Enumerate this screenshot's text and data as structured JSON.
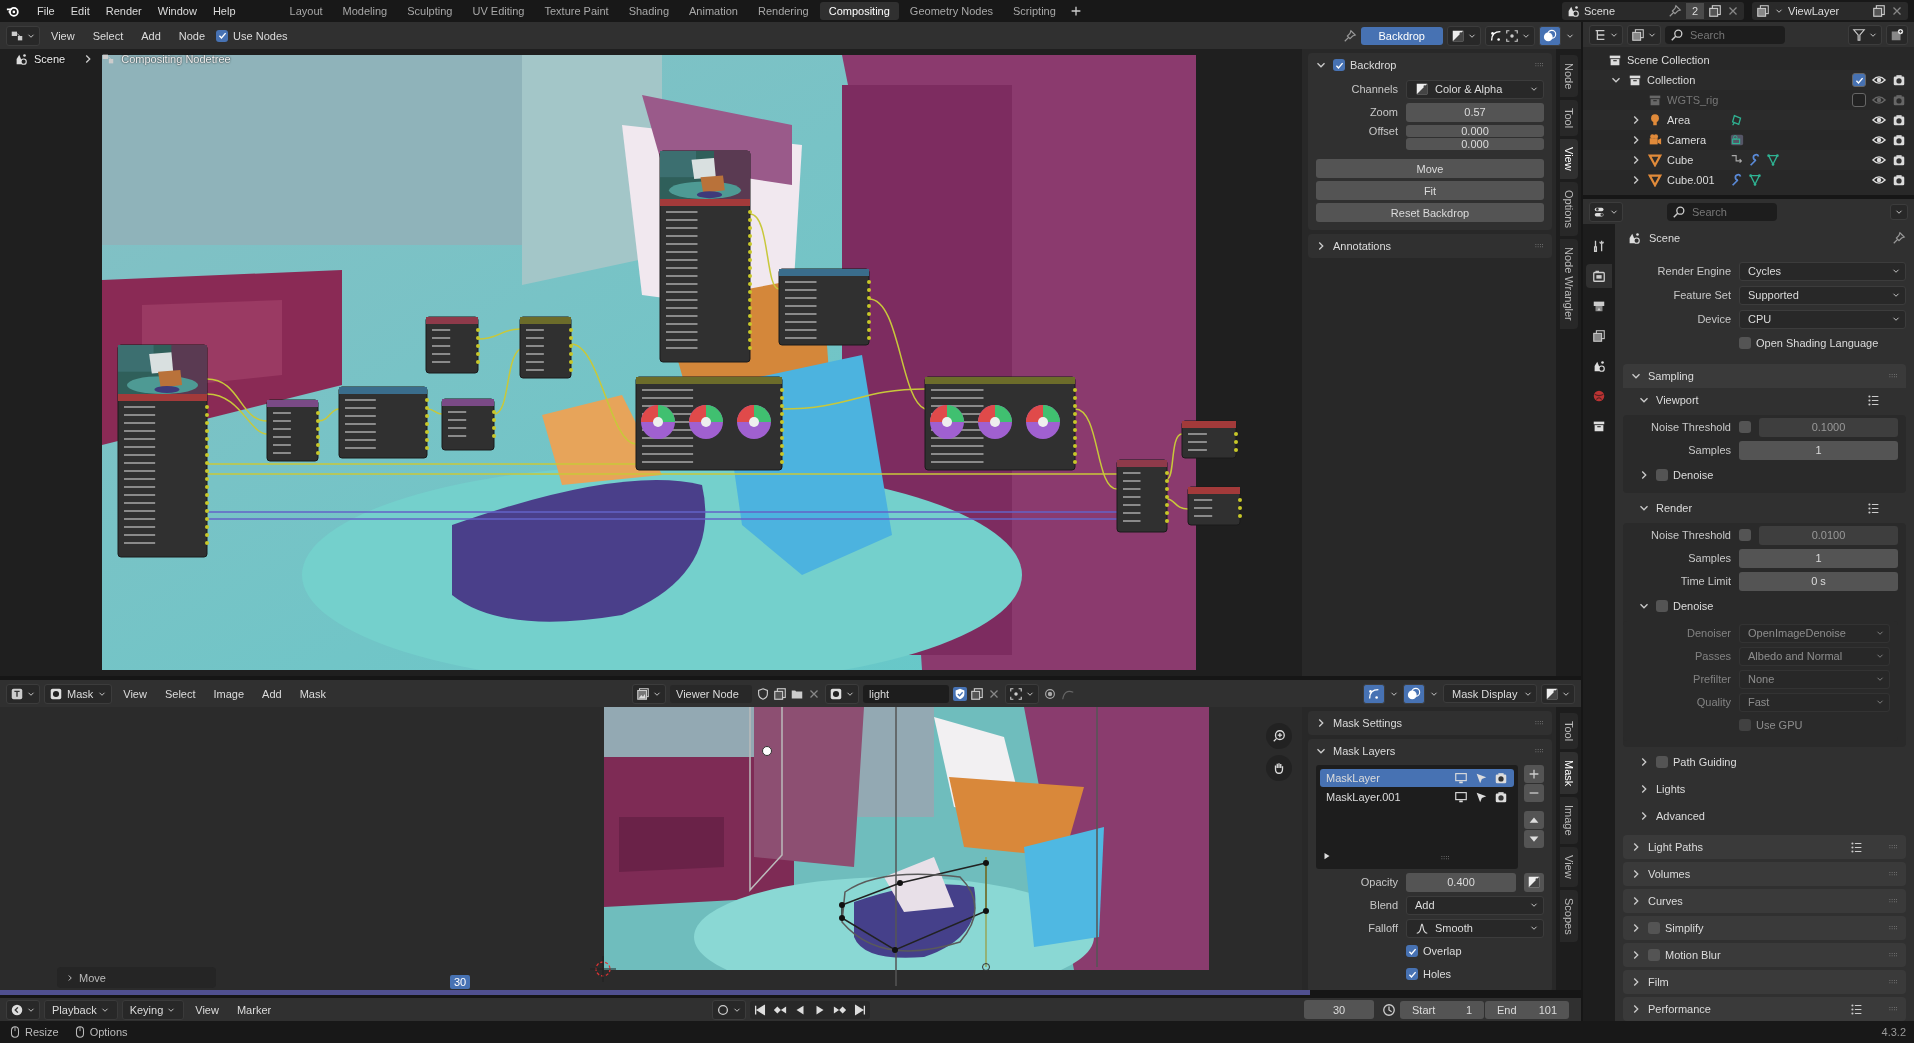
{
  "top_bar": {
    "menus": [
      "File",
      "Edit",
      "Render",
      "Window",
      "Help"
    ],
    "workspaces": [
      {
        "label": "Layout",
        "selected": false
      },
      {
        "label": "Modeling",
        "selected": false
      },
      {
        "label": "Sculpting",
        "selected": false
      },
      {
        "label": "UV Editing",
        "selected": false
      },
      {
        "label": "Texture Paint",
        "selected": false
      },
      {
        "label": "Shading",
        "selected": false
      },
      {
        "label": "Animation",
        "selected": false
      },
      {
        "label": "Rendering",
        "selected": false
      },
      {
        "label": "Compositing",
        "selected": true
      },
      {
        "label": "Geometry Nodes",
        "selected": false
      },
      {
        "label": "Scripting",
        "selected": false
      }
    ],
    "scene": "Scene",
    "scene_users": "2",
    "view_layer": "ViewLayer"
  },
  "node_editor": {
    "menus": [
      "View",
      "Select",
      "Add",
      "Node"
    ],
    "use_nodes": {
      "label": "Use Nodes",
      "checked": true
    },
    "backdrop_button": {
      "label": "Backdrop",
      "on": true
    },
    "breadcrumbs": [
      "Scene",
      "Compositing Nodetree"
    ],
    "sidebar": {
      "tabs": [
        {
          "label": "Node",
          "selected": false
        },
        {
          "label": "Tool",
          "selected": false
        },
        {
          "label": "View",
          "selected": true
        },
        {
          "label": "Options",
          "selected": false
        },
        {
          "label": "Node Wrangler",
          "selected": false
        }
      ],
      "panels": [
        {
          "title": "Backdrop",
          "checked": true,
          "expanded": true,
          "rows": [
            {
              "kind": "channels-dropdown",
              "label": "Channels",
              "value": "Color & Alpha"
            },
            {
              "kind": "number",
              "label": "Zoom",
              "value": "0.57"
            },
            {
              "kind": "vector",
              "label": "Offset",
              "values": [
                "0.000",
                "0.000"
              ]
            },
            {
              "kind": "button",
              "label": "Move"
            },
            {
              "kind": "button",
              "label": "Fit"
            },
            {
              "kind": "button",
              "label": "Reset Backdrop"
            }
          ]
        },
        {
          "title": "Annotations",
          "expanded": false
        }
      ]
    }
  },
  "image_editor": {
    "mode": "Mask",
    "menus": [
      "View",
      "Select",
      "Image",
      "Add",
      "Mask"
    ],
    "image": "Viewer Node",
    "mask": "light",
    "mask_display": "Mask Display",
    "last_operator": "Move",
    "current_frame": "30",
    "sidebar": {
      "tabs": [
        {
          "label": "Tool",
          "selected": false
        },
        {
          "label": "Mask",
          "selected": true
        },
        {
          "label": "Image",
          "selected": false
        },
        {
          "label": "View",
          "selected": false
        },
        {
          "label": "Scopes",
          "selected": false
        }
      ],
      "panels": [
        {
          "title": "Mask Settings",
          "expanded": false
        },
        {
          "title": "Mask Layers",
          "expanded": true,
          "layers": [
            {
              "name": "MaskLayer",
              "selected": true
            },
            {
              "name": "MaskLayer.001",
              "selected": false
            }
          ],
          "rows": [
            {
              "kind": "number-toggle",
              "label": "Opacity",
              "value": "0.400"
            },
            {
              "kind": "dropdown",
              "label": "Blend",
              "value": "Add"
            },
            {
              "kind": "falloff-dropdown",
              "label": "Falloff",
              "value": "Smooth"
            },
            {
              "kind": "checkbox",
              "label": "Overlap",
              "checked": true
            },
            {
              "kind": "checkbox",
              "label": "Holes",
              "checked": true
            }
          ]
        }
      ]
    }
  },
  "timeline": {
    "menus": [
      "Playback",
      "Keying",
      "View",
      "Marker"
    ],
    "current_frame": "30",
    "start_label": "Start",
    "start": "1",
    "end_label": "End",
    "end": "101"
  },
  "status_bar": {
    "items": [
      "Resize",
      "Options"
    ],
    "version": "4.3.2"
  },
  "outliner": {
    "search_placeholder": "Search",
    "tree": [
      {
        "label": "Scene Collection",
        "kind": "scene-collection",
        "children": [
          {
            "label": "Collection",
            "kind": "collection",
            "expanded": true,
            "checked": true,
            "children": [
              {
                "label": "WGTS_rig",
                "kind": "collection",
                "checked": false
              },
              {
                "label": "Area",
                "kind": "light",
                "expanded": false,
                "constraint": false,
                "modifier": false
              },
              {
                "label": "Camera",
                "kind": "camera",
                "expanded": false,
                "constraint": false,
                "modifier": false
              },
              {
                "label": "Cube",
                "kind": "mesh",
                "expanded": false,
                "constraint": true,
                "modifier": true
              },
              {
                "label": "Cube.001",
                "kind": "mesh",
                "expanded": false,
                "constraint": false,
                "modifier": true
              }
            ]
          }
        ]
      }
    ]
  },
  "properties": {
    "search_placeholder": "Search",
    "context": "Scene",
    "tabs": [
      {
        "kind": "tool",
        "selected": false
      },
      {
        "kind": "render",
        "selected": true
      },
      {
        "kind": "output",
        "selected": false
      },
      {
        "kind": "view-layer",
        "selected": false
      },
      {
        "kind": "scene",
        "selected": false
      },
      {
        "kind": "world",
        "selected": false
      },
      {
        "kind": "collection",
        "selected": false
      }
    ],
    "rows": [
      {
        "kind": "dropdown",
        "label": "Render Engine",
        "value": "Cycles"
      },
      {
        "kind": "dropdown",
        "label": "Feature Set",
        "value": "Supported"
      },
      {
        "kind": "dropdown",
        "label": "Device",
        "value": "CPU"
      },
      {
        "kind": "checkbox",
        "label": "Open Shading Language",
        "checked": false
      }
    ],
    "panels": [
      {
        "title": "Sampling",
        "expanded": true,
        "children": [
          {
            "kind": "subpanel",
            "title": "Viewport",
            "expanded": true,
            "presets": true,
            "children": [
              {
                "kind": "toggle-number",
                "label": "Noise Threshold",
                "checked": false,
                "value": "0.1000"
              },
              {
                "kind": "number",
                "label": "Samples",
                "value": "1"
              },
              {
                "kind": "subpanel",
                "title": "Denoise",
                "expanded": false,
                "checked": false
              }
            ]
          },
          {
            "kind": "subpanel",
            "title": "Render",
            "expanded": true,
            "presets": true,
            "children": [
              {
                "kind": "toggle-number",
                "label": "Noise Threshold",
                "checked": false,
                "value": "0.0100"
              },
              {
                "kind": "number",
                "label": "Samples",
                "value": "1"
              },
              {
                "kind": "number",
                "label": "Time Limit",
                "value": "0 s"
              },
              {
                "kind": "subpanel",
                "title": "Denoise",
                "expanded": true,
                "checked": false,
                "children": [
                  {
                    "kind": "dropdown",
                    "label": "Denoiser",
                    "value": "OpenImageDenoise",
                    "disabled": true
                  },
                  {
                    "kind": "dropdown",
                    "label": "Passes",
                    "value": "Albedo and Normal",
                    "disabled": true
                  },
                  {
                    "kind": "dropdown",
                    "label": "Prefilter",
                    "value": "None",
                    "disabled": true
                  },
                  {
                    "kind": "dropdown",
                    "label": "Quality",
                    "value": "Fast",
                    "disabled": true
                  },
                  {
                    "kind": "checkbox",
                    "label": "Use GPU",
                    "checked": false,
                    "disabled": true
                  }
                ]
              }
            ]
          },
          {
            "kind": "subpanel",
            "title": "Path Guiding",
            "expanded": false,
            "checked": false
          },
          {
            "kind": "subpanel",
            "title": "Lights",
            "expanded": false
          },
          {
            "kind": "subpanel",
            "title": "Advanced",
            "expanded": false
          }
        ]
      },
      {
        "title": "Light Paths",
        "expanded": false,
        "presets": true
      },
      {
        "title": "Volumes",
        "expanded": false
      },
      {
        "title": "Curves",
        "expanded": false
      },
      {
        "title": "Simplify",
        "expanded": false,
        "checked": false
      },
      {
        "title": "Motion Blur",
        "expanded": false,
        "checked": false
      },
      {
        "title": "Film",
        "expanded": false
      },
      {
        "title": "Performance",
        "expanded": false,
        "presets": true
      }
    ]
  }
}
